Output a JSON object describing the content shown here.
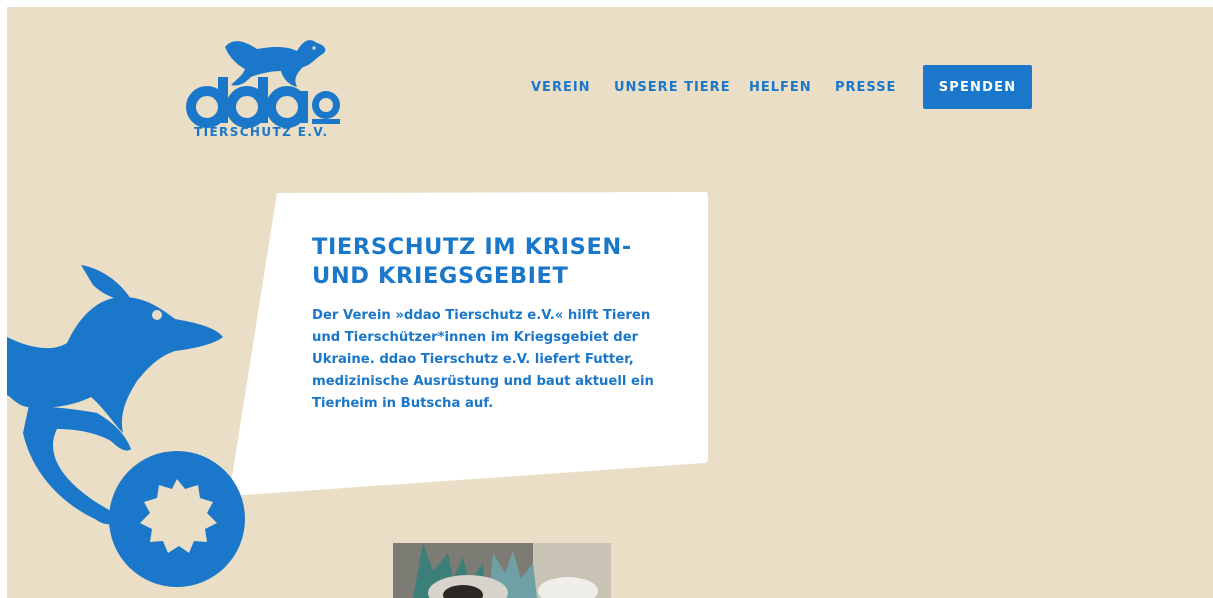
{
  "logo": {
    "wordmark": "ddao",
    "subtitle": "TIERSCHUTZ E.V.",
    "icon": "running-dog-icon"
  },
  "nav": {
    "items": [
      {
        "label": "VEREIN"
      },
      {
        "label": "UNSERE TIERE"
      },
      {
        "label": "HELFEN"
      },
      {
        "label": "PRESSE"
      }
    ],
    "donate_label": "SPENDEN"
  },
  "hero": {
    "title_line1": "TIERSCHUTZ IM KRISEN-",
    "title_line2": "UND KRIEGSGEBIET",
    "text_lines": [
      "Der Verein »ddao Tierschutz e.V.« hilft Tieren",
      "und Tierschützer*innen im Kriegsgebiet der",
      "Ukraine. ddao Tierschutz e.V. liefert Futter,",
      "medizinische Ausrüstung und baut aktuell ein",
      "Tierheim in Butscha auf."
    ],
    "illustration": "dog-with-wheel-icon"
  },
  "colors": {
    "background": "#eadfc6",
    "brand_blue": "#1a77c9",
    "card": "#ffffff"
  }
}
